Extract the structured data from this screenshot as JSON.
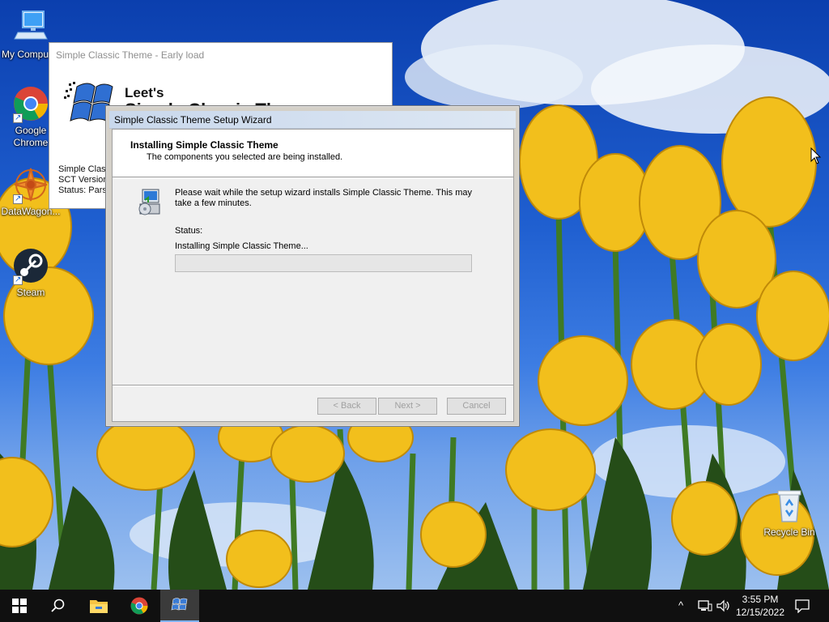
{
  "desktop": {
    "icons": [
      {
        "label": "My Compu",
        "icon": "computer-icon"
      },
      {
        "label": "Google Chrome",
        "icon": "chrome-icon"
      },
      {
        "label": "DataWagon...",
        "icon": "datawagon-icon"
      },
      {
        "label": "Steam",
        "icon": "steam-icon"
      },
      {
        "label": "Recycle Bin",
        "icon": "recycle-bin-icon"
      }
    ]
  },
  "early_window": {
    "title": "Simple Classic Theme - Early load",
    "logo_line1": "Leet's",
    "logo_line2": "Simple Classic Theme",
    "info_line1": "Simple Class",
    "info_line2": "SCT Version",
    "info_line3": "Status: Parsi"
  },
  "wizard": {
    "title": "Simple Classic Theme Setup Wizard",
    "header_title": "Installing Simple Classic Theme",
    "header_subtitle": "The components you selected are being installed.",
    "body_text": "Please wait while the setup wizard installs Simple Classic Theme. This may take a few minutes.",
    "status_label": "Status:",
    "status_value": "Installing Simple Classic Theme...",
    "progress_fraction": 0,
    "buttons": {
      "back": "< Back",
      "next": "Next >",
      "cancel": "Cancel"
    }
  },
  "taskbar": {
    "items": [
      "start-icon",
      "search-icon",
      "file-explorer-icon",
      "chrome-icon",
      "simple-classic-theme-icon"
    ],
    "clock_time": "3:55 PM",
    "clock_date": "12/15/2022",
    "tray_chevron": "^"
  },
  "colors": {
    "taskbar": "#101010",
    "dialog_face": "#d4d0c8",
    "dialog_client": "#f0f0f0",
    "wallpaper_sky": "#1f5fd0",
    "tulip": "#f2bf1c"
  }
}
